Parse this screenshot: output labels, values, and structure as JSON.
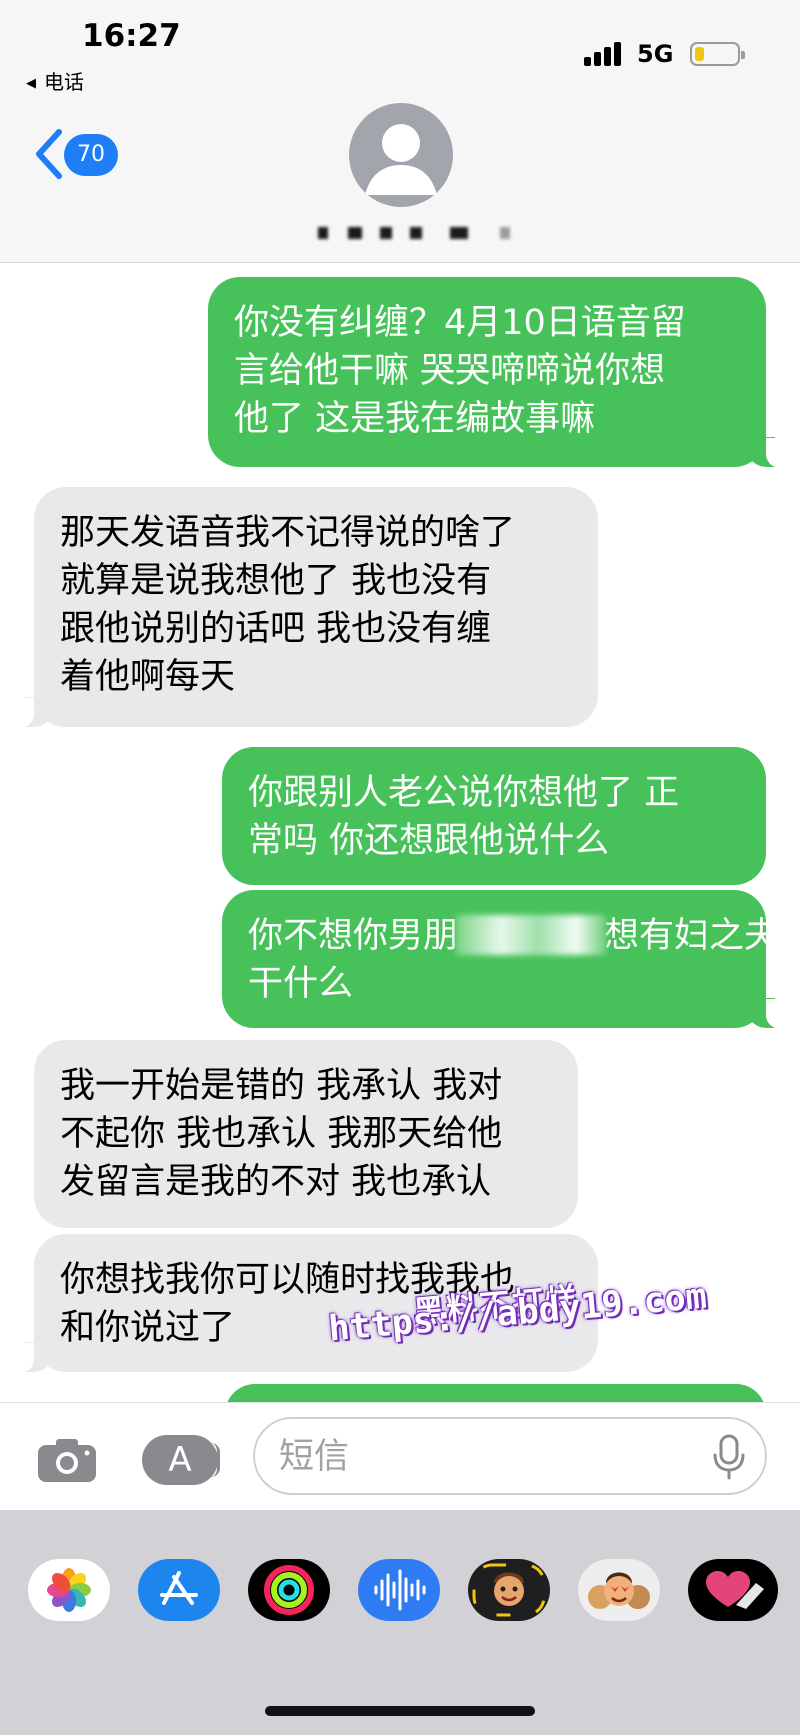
{
  "status_bar": {
    "time": "16:27",
    "back_app": "电话",
    "network": "5G",
    "battery_color": "#f2c511"
  },
  "header": {
    "unread_count": "70",
    "avatar_icon": "person-silhouette-icon",
    "contact_name_redacted": true
  },
  "colors": {
    "outgoing_bubble": "#47c25a",
    "incoming_bubble": "#e9e9eb",
    "unread_badge": "#1e7ef5"
  },
  "messages": [
    {
      "direction": "out",
      "lines": [
        "你没有纠缠？4月10日语音留",
        "言给他干嘛  哭哭啼啼说你想",
        "他了  这是我在编故事嘛"
      ]
    },
    {
      "direction": "in",
      "lines": [
        "那天发语音我不记得说的啥了",
        "就算是说我想他了 我也没有",
        "跟他说别的话吧 我也没有缠",
        "着他啊每天"
      ]
    },
    {
      "direction": "out",
      "lines": [
        "你跟别人老公说你想他了  正",
        "常吗  你还想跟他说什么"
      ]
    },
    {
      "direction": "out",
      "lines_before_blur": "你不想你男朋",
      "lines_after_blur": "想有妇之夫",
      "lines_rest": [
        "干什么"
      ]
    },
    {
      "direction": "in",
      "lines": [
        "我一开始是错的 我承认 我对",
        "不起你 我也承认 我那天给他",
        "发留言是我的不对 我也承认"
      ]
    },
    {
      "direction": "in",
      "lines": [
        "你想找我你可以随时找我我也",
        "和你说过了"
      ]
    }
  ],
  "watermark": {
    "line1": "黑料不打烊",
    "line2": "https://abdy19.com"
  },
  "input": {
    "placeholder": "短信",
    "value": ""
  },
  "app_drawer": {
    "apps": [
      "photos-app-icon",
      "app-store-icon",
      "activity-app-icon",
      "audio-message-icon",
      "memoji-icon",
      "memoji-stickers-icon",
      "digital-touch-icon"
    ]
  }
}
